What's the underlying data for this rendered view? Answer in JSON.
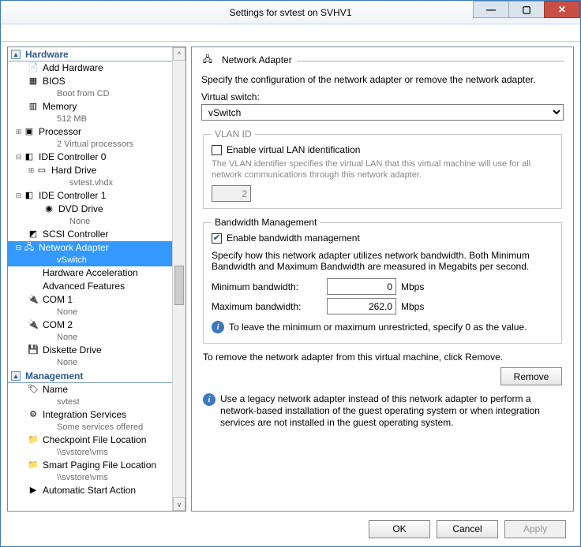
{
  "window": {
    "title": "Settings for svtest on SVHV1"
  },
  "winbuttons": {
    "min": "—",
    "max": "▢",
    "close": "✕"
  },
  "tree": {
    "hardware_header": "Hardware",
    "management_header": "Management",
    "add_hardware": "Add Hardware",
    "bios": "BIOS",
    "bios_sub": "Boot from CD",
    "memory": "Memory",
    "memory_sub": "512 MB",
    "processor": "Processor",
    "processor_sub": "2 Virtual processors",
    "ide0": "IDE Controller 0",
    "hard_drive": "Hard Drive",
    "hard_drive_sub": "svtest.vhdx",
    "ide1": "IDE Controller 1",
    "dvd": "DVD Drive",
    "dvd_sub": "None",
    "scsi": "SCSI Controller",
    "net": "Network Adapter",
    "net_sub": "vSwitch",
    "hw_accel": "Hardware Acceleration",
    "adv_feat": "Advanced Features",
    "com1": "COM 1",
    "com1_sub": "None",
    "com2": "COM 2",
    "com2_sub": "None",
    "diskette": "Diskette Drive",
    "diskette_sub": "None",
    "name": "Name",
    "name_sub": "svtest",
    "integ": "Integration Services",
    "integ_sub": "Some services offered",
    "checkpoint": "Checkpoint File Location",
    "checkpoint_sub": "\\\\svstore\\vms",
    "smart": "Smart Paging File Location",
    "smart_sub": "\\\\svstore\\vms",
    "autostart": "Automatic Start Action"
  },
  "panel": {
    "title": "Network Adapter",
    "desc": "Specify the configuration of the network adapter or remove the network adapter.",
    "vswitch_label": "Virtual switch:",
    "vswitch_value": "vSwitch",
    "vlan_legend": "VLAN ID",
    "vlan_enable": "Enable virtual LAN identification",
    "vlan_help": "The VLAN identifier specifies the virtual LAN that this virtual machine will use for all network communications through this network adapter.",
    "vlan_value": "2",
    "bw_legend": "Bandwidth Management",
    "bw_enable": "Enable bandwidth management",
    "bw_desc": "Specify how this network adapter utilizes network bandwidth. Both Minimum Bandwidth and Maximum Bandwidth are measured in Megabits per second.",
    "min_label": "Minimum bandwidth:",
    "min_value": "0",
    "max_label": "Maximum bandwidth:",
    "max_value": "262.0",
    "mbps": "Mbps",
    "bw_info": "To leave the minimum or maximum unrestricted, specify 0 as the value.",
    "remove_desc": "To remove the network adapter from this virtual machine, click Remove.",
    "remove_btn": "Remove",
    "legacy_info": "Use a legacy network adapter instead of this network adapter to perform a network-based installation of the guest operating system or when integration services are not installed in the guest operating system."
  },
  "footer": {
    "ok": "OK",
    "cancel": "Cancel",
    "apply": "Apply"
  }
}
